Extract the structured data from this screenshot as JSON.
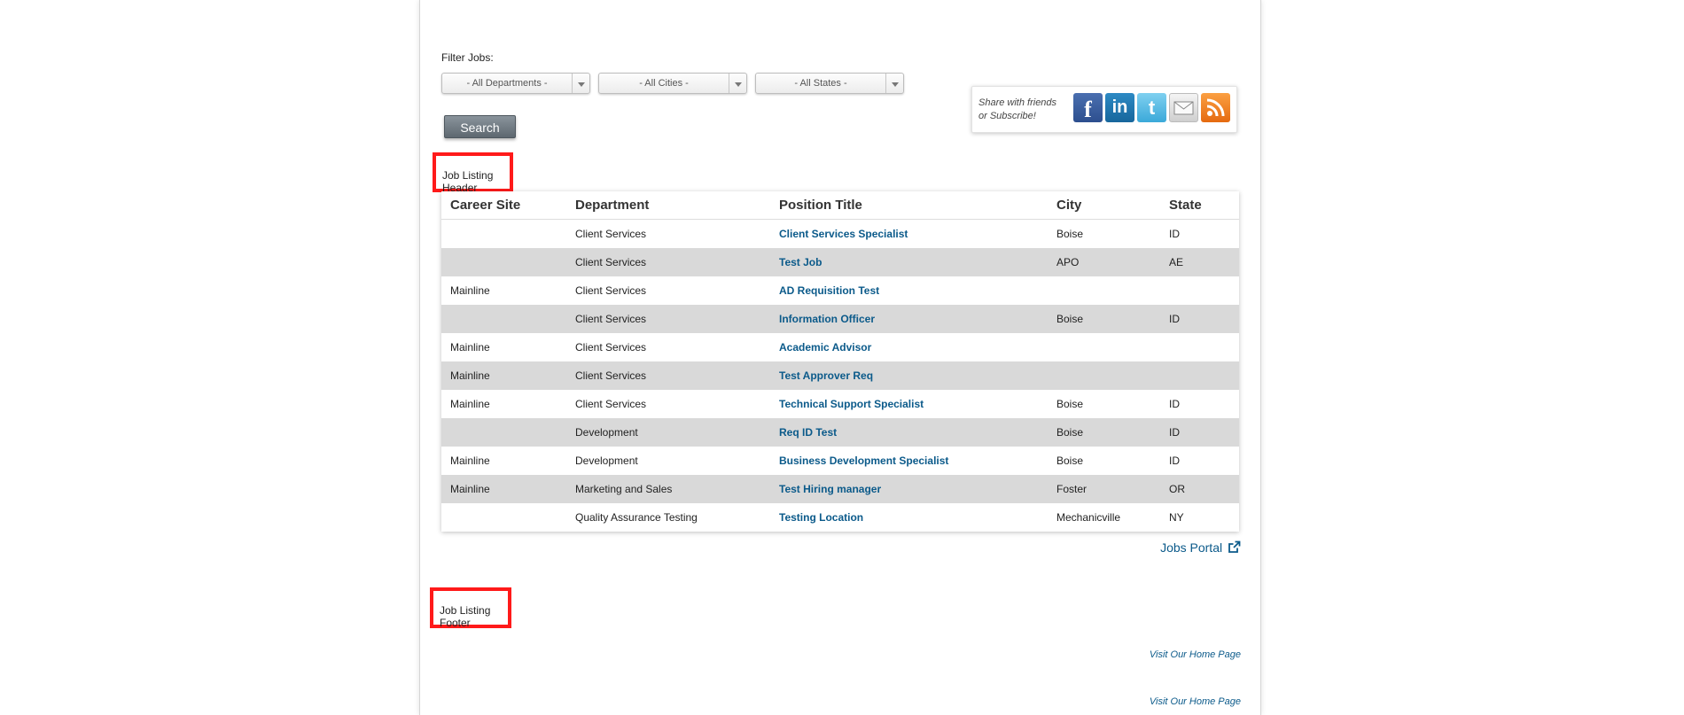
{
  "filter": {
    "label": "Filter Jobs:",
    "department": "- All Departments -",
    "city": "- All Cities -",
    "state": "- All States -",
    "search_label": "Search"
  },
  "share": {
    "line1": "Share with friends",
    "line2": "or Subscribe!",
    "icons": [
      "facebook-icon",
      "linkedin-icon",
      "twitter-icon",
      "email-icon",
      "rss-icon"
    ]
  },
  "header_box": "Job Listing Header",
  "footer_box": "Job Listing Footer",
  "table": {
    "columns": [
      "Career Site",
      "Department",
      "Position Title",
      "City",
      "State"
    ],
    "rows": [
      {
        "site": "",
        "dept": "Client Services",
        "title": "Client Services Specialist",
        "city": "Boise",
        "state": "ID"
      },
      {
        "site": "",
        "dept": "Client Services",
        "title": "Test Job",
        "city": "APO",
        "state": "AE"
      },
      {
        "site": "Mainline",
        "dept": "Client Services",
        "title": "AD Requisition Test",
        "city": "",
        "state": ""
      },
      {
        "site": "",
        "dept": "Client Services",
        "title": "Information Officer",
        "city": "Boise",
        "state": "ID"
      },
      {
        "site": "Mainline",
        "dept": "Client Services",
        "title": "Academic Advisor",
        "city": "",
        "state": ""
      },
      {
        "site": "Mainline",
        "dept": "Client Services",
        "title": "Test Approver Req",
        "city": "",
        "state": ""
      },
      {
        "site": "Mainline",
        "dept": "Client Services",
        "title": "Technical Support Specialist",
        "city": "Boise",
        "state": "ID"
      },
      {
        "site": "",
        "dept": "Development",
        "title": "Req ID Test",
        "city": "Boise",
        "state": "ID"
      },
      {
        "site": "Mainline",
        "dept": "Development",
        "title": "Business Development Specialist",
        "city": "Boise",
        "state": "ID"
      },
      {
        "site": "Mainline",
        "dept": "Marketing and Sales",
        "title": "Test Hiring manager",
        "city": "Foster",
        "state": "OR"
      },
      {
        "site": "",
        "dept": "Quality Assurance Testing",
        "title": "Testing Location",
        "city": "Mechanicville",
        "state": "NY"
      }
    ]
  },
  "portal_label": "Jobs Portal",
  "visit_links": [
    "Visit Our Home Page",
    "Visit Our Home Page"
  ],
  "colors": {
    "link": "#0b5a8a",
    "red_box": "#ff1a1a",
    "alt_row": "#d9d9d9"
  }
}
